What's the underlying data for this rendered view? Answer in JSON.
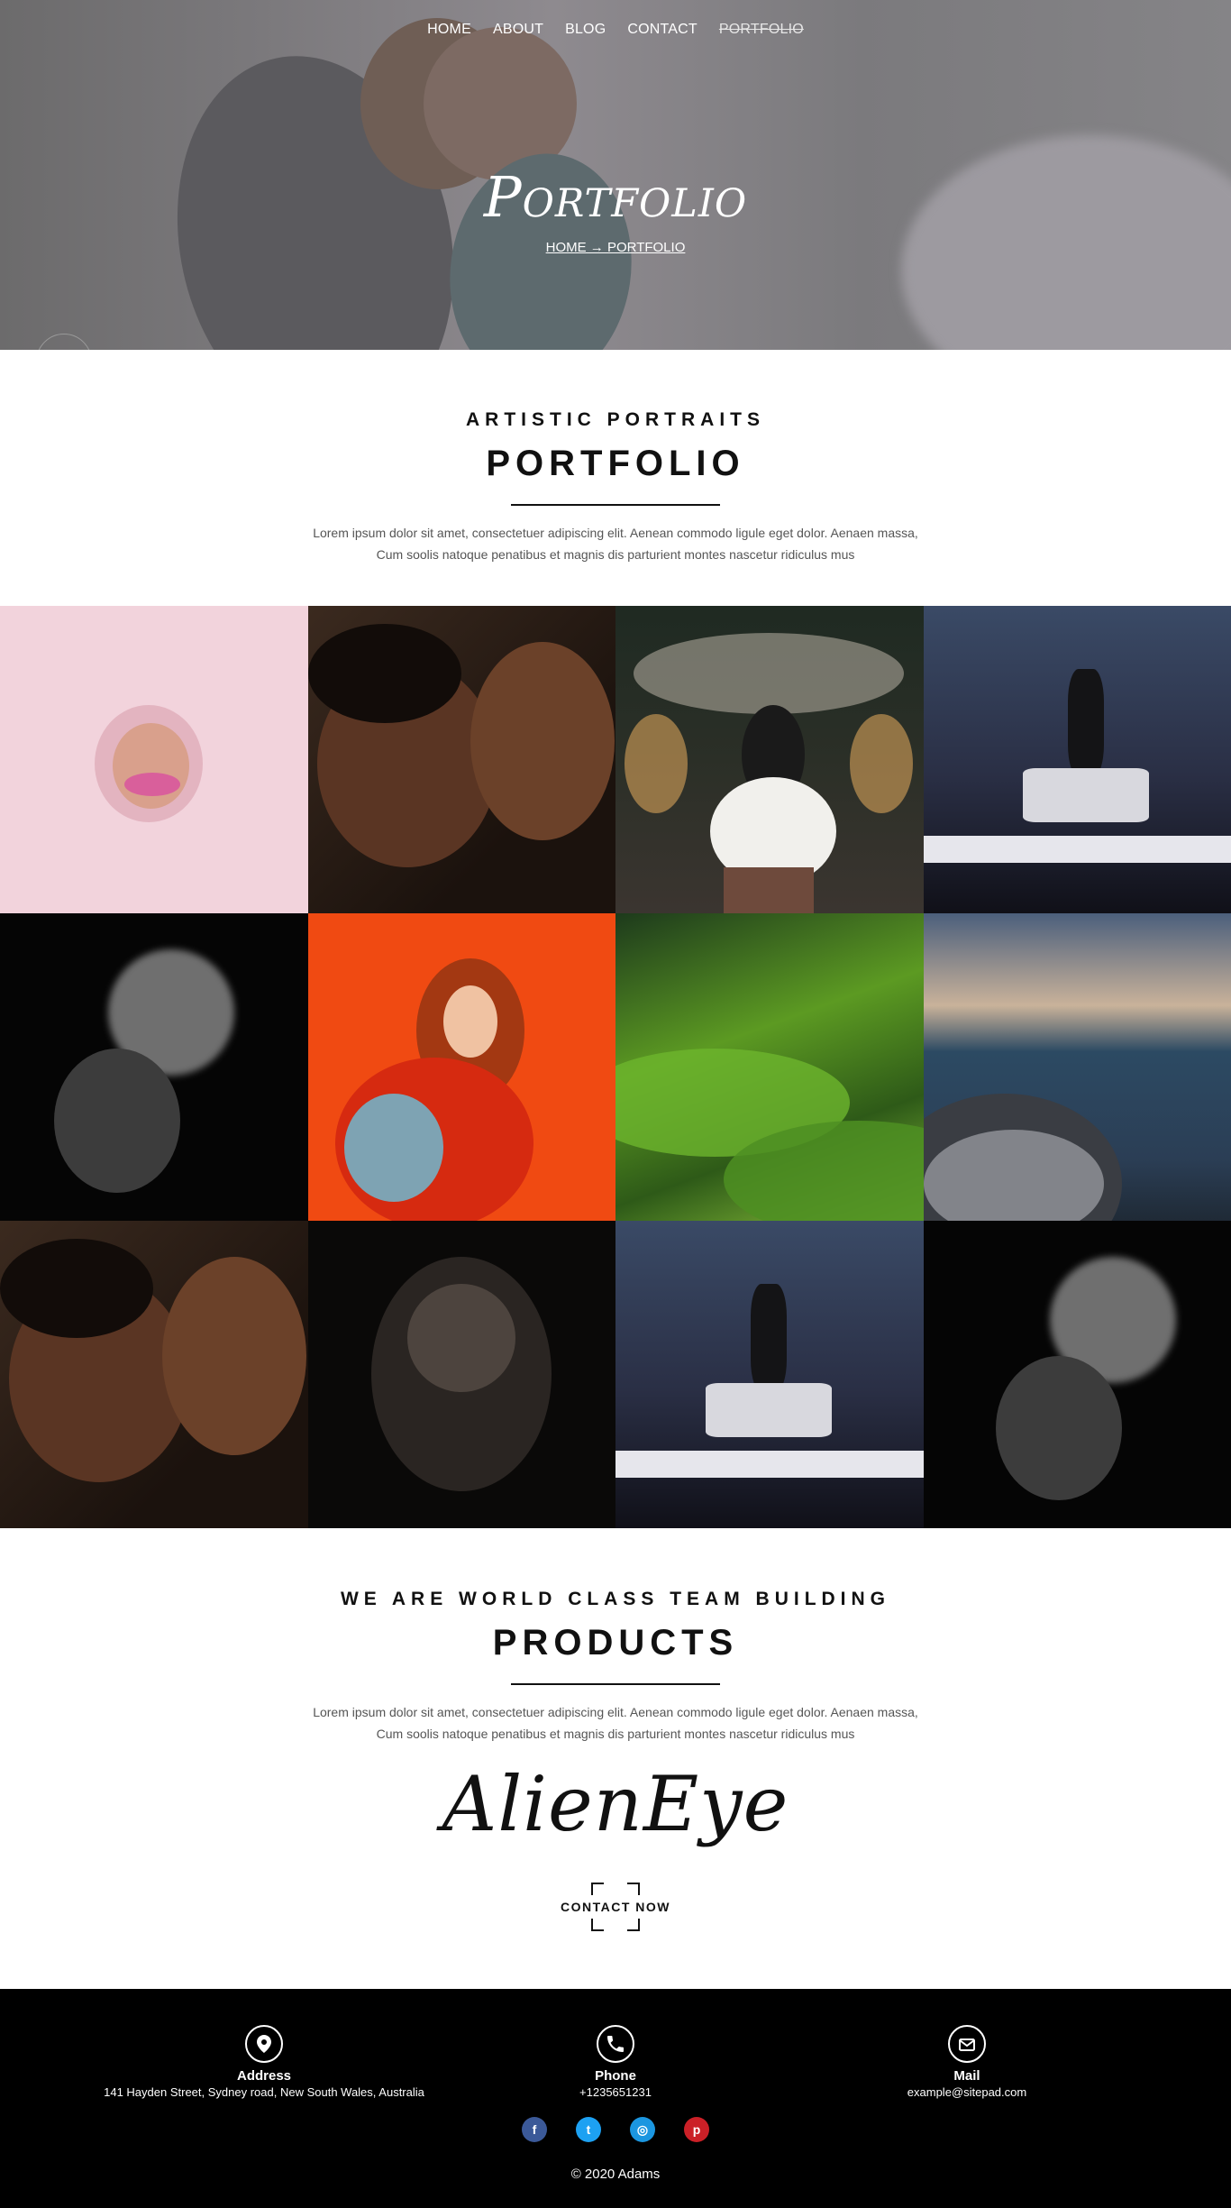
{
  "nav": {
    "items": [
      "HOME",
      "ABOUT",
      "BLOG",
      "CONTACT",
      "PORTFOLIO"
    ]
  },
  "hero": {
    "title": "Portfolio",
    "breadcrumb": "HOME → PORTFOLIO"
  },
  "portfolio_section": {
    "kicker": "ARTISTIC PORTRAITS",
    "title": "PORTFOLIO",
    "text_line1": "Lorem ipsum dolor sit amet, consectetuer adipiscing elit. Aenean commodo ligule eget dolor. Aenaen massa,",
    "text_line2": "Cum soolis natoque penatibus et magnis dis parturient montes nascetur ridiculus mus"
  },
  "gallery": {
    "tiles": [
      "lips-on-pink",
      "embracing-couple",
      "wedding-kiss",
      "boxer-entrance",
      "smoke-figure",
      "redhead-on-orange",
      "green-hills",
      "rocky-coast",
      "embracing-couple",
      "crouching-figure",
      "boxer-entrance",
      "smoke-figure"
    ]
  },
  "products_section": {
    "kicker": "WE ARE WORLD CLASS TEAM BUILDING",
    "title": "PRODUCTS",
    "text_line1": "Lorem ipsum dolor sit amet, consectetuer adipiscing elit. Aenean commodo ligule eget dolor. Aenaen massa,",
    "text_line2": "Cum soolis natoque penatibus et magnis dis parturient montes nascetur ridiculus mus",
    "logo": "AlienEye",
    "cta": "CONTACT NOW"
  },
  "footer": {
    "address_title": "Address",
    "address_value": "141 Hayden Street, Sydney road, New South Wales, Australia",
    "phone_title": "Phone",
    "phone_value": "+1235651231",
    "mail_title": "Mail",
    "mail_value": "example@sitepad.com",
    "copyright": "© 2020 Adams",
    "social_icons": [
      "facebook-icon",
      "twitter-icon",
      "instagram-icon",
      "pinterest-icon"
    ],
    "social_colors": [
      "#3b5998",
      "#1da1f2",
      "#1b96e0",
      "#cb2027"
    ]
  }
}
